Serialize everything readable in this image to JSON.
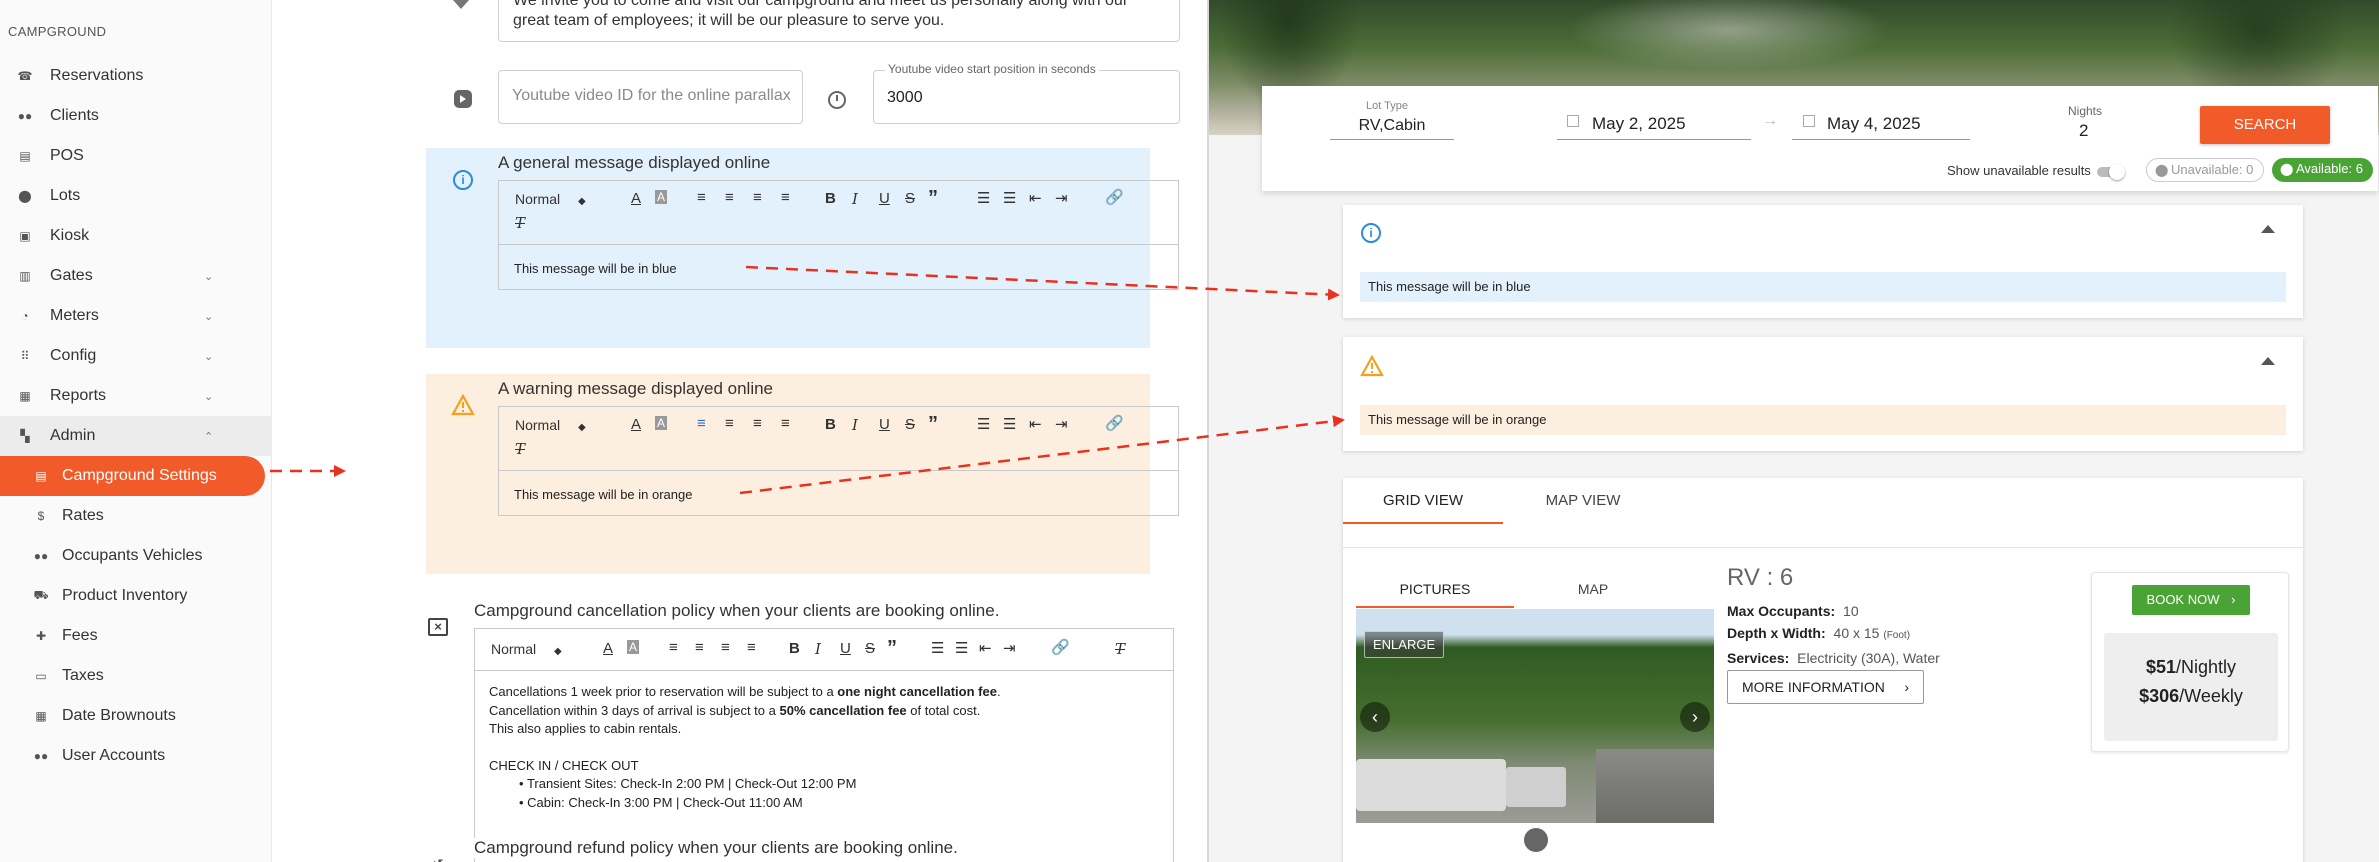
{
  "sidebar": {
    "section_label": "CAMPGROUND",
    "items": [
      {
        "label": "Reservations",
        "icon": "phone-icon"
      },
      {
        "label": "Clients",
        "icon": "people-icon"
      },
      {
        "label": "POS",
        "icon": "store-icon"
      },
      {
        "label": "Lots",
        "icon": "location-pin-icon"
      },
      {
        "label": "Kiosk",
        "icon": "kiosk-icon"
      },
      {
        "label": "Gates",
        "icon": "gate-icon"
      },
      {
        "label": "Meters",
        "icon": "meter-icon"
      },
      {
        "label": "Config",
        "icon": "grid-icon"
      },
      {
        "label": "Reports",
        "icon": "print-icon"
      },
      {
        "label": "Admin",
        "icon": "dashboard-icon"
      },
      {
        "label": "Campground Settings",
        "icon": "store-icon"
      },
      {
        "label": "Rates",
        "icon": "money-icon"
      },
      {
        "label": "Occupants Vehicles",
        "icon": "people-icon"
      },
      {
        "label": "Product Inventory",
        "icon": "cart-icon"
      },
      {
        "label": "Fees",
        "icon": "puzzle-icon"
      },
      {
        "label": "Taxes",
        "icon": "receipt-icon"
      },
      {
        "label": "Date Brownouts",
        "icon": "calendar-icon"
      },
      {
        "label": "User Accounts",
        "icon": "people-icon"
      }
    ]
  },
  "form": {
    "intro_text_line1": "We invite you to come and visit our campground and meet us personally along with our",
    "intro_text_line2": "great team of employees; it will be our pleasure to serve you.",
    "youtube_placeholder": "Youtube video ID for the online parallax",
    "youtube_start_label": "Youtube video start position in seconds",
    "youtube_start_value": "3000",
    "general_title": "A general message displayed online",
    "general_text": "This message will be in blue",
    "warning_title": "A warning message displayed online",
    "warning_text": "This message will be in orange",
    "toolbar_format": "Normal",
    "cancel_title": "Campground cancellation policy when your clients are booking online.",
    "cancel_lines": {
      "l1_pre": "Cancellations 1 week prior to reservation will be subject to a ",
      "l1_bold": "one night cancellation fee",
      "l1_post": ".",
      "l2_pre": "Cancellation within 3 days of arrival is subject to a ",
      "l2_bold": "50% cancellation fee",
      "l2_post": " of total cost.",
      "l3": "This also applies to cabin rentals.",
      "l4": "CHECK IN / CHECK OUT",
      "l5": "Transient Sites: Check-In 2:00 PM | Check-Out 12:00 PM",
      "l6": "Cabin: Check-In 3:00 PM | Check-Out 11:00 AM"
    },
    "refund_title": "Campground refund policy when your clients are booking online."
  },
  "preview": {
    "lot_type_label": "Lot Type",
    "lot_type_value": "RV,Cabin",
    "date_from": "May 2, 2025",
    "date_to": "May 4, 2025",
    "nights_label": "Nights",
    "nights_value": "2",
    "search_label": "SEARCH",
    "show_unavailable": "Show unavailable results",
    "unavailable_chip": "Unavailable: 0",
    "available_chip": "Available: 6",
    "info_message": "This message will be in blue",
    "warning_message": "This message will be in orange",
    "tab_grid": "GRID VIEW",
    "tab_map": "MAP VIEW",
    "sub_tab_pictures": "PICTURES",
    "sub_tab_map": "MAP",
    "enlarge": "ENLARGE",
    "lot_title": "RV : 6",
    "max_occupants_label": "Max Occupants:",
    "max_occupants_value": "10",
    "depth_label": "Depth x Width:",
    "depth_value": "40 x 15",
    "depth_unit": "(Foot)",
    "services_label": "Services:",
    "services_value": "Electricity (30A), Water",
    "more_info": "MORE INFORMATION",
    "book_now": "BOOK NOW",
    "price_nightly": "$51",
    "price_nightly_unit": "/Nightly",
    "price_weekly": "$306",
    "price_weekly_unit": "/Weekly"
  },
  "colors": {
    "accent": "#f15a29",
    "info_bg": "#e3f1fd",
    "warning_bg": "#fdefdf",
    "available": "#4aa335",
    "info_icon": "#2a8be0",
    "warning_icon": "#f3a01d"
  }
}
